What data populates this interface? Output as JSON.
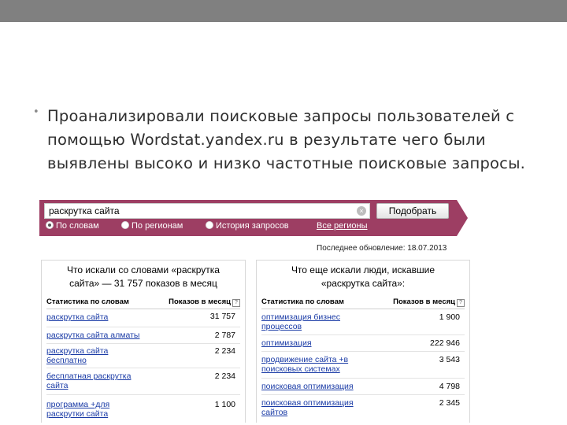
{
  "slide": {
    "bullet": "•",
    "text": "Проанализировали поисковые запросы пользователей с помощью Wordstat.yandex.ru в результате чего были выявлены высоко и низко частотные поисковые запросы."
  },
  "search": {
    "query": "раскрутка сайта",
    "button_label": "Подобрать",
    "clear_glyph": "×"
  },
  "modes": [
    {
      "label": "По словам",
      "selected": true
    },
    {
      "label": "По регионам",
      "selected": false
    },
    {
      "label": "История запросов",
      "selected": false
    }
  ],
  "all_regions": "Все регионы",
  "last_update": "Последнее обновление: 18.07.2013",
  "left_table": {
    "title": "Что искали со словами «раскрутка сайта» — 31 757 показов в месяц",
    "col_words": "Статистика по словам",
    "col_shows": "Показов в месяц",
    "help_glyph": "?",
    "rows": [
      {
        "keyword": "раскрутка сайта",
        "count": "31 757"
      },
      {
        "keyword": "раскрутка сайта алматы",
        "count": "2 787"
      },
      {
        "keyword": "раскрутка сайта бесплатно",
        "count": "2 234"
      },
      {
        "keyword": "бесплатная раскрутка сайта",
        "count": "2 234"
      },
      {
        "keyword": "программа +для раскрутки сайта",
        "count": "1 100"
      }
    ]
  },
  "right_table": {
    "title": "Что еще искали люди, искавшие «раскрутка сайта»:",
    "col_words": "Статистика по словам",
    "col_shows": "Показов в месяц",
    "help_glyph": "?",
    "rows": [
      {
        "keyword": "оптимизация бизнес процессов",
        "count": "1 900"
      },
      {
        "keyword": "оптимизация",
        "count": "222 946"
      },
      {
        "keyword": "продвижение сайта +в поисковых системах",
        "count": "3 543"
      },
      {
        "keyword": "поисковая оптимизация",
        "count": "4 798"
      },
      {
        "keyword": "поисковая оптимизация сайтов",
        "count": "2 345"
      }
    ]
  },
  "colors": {
    "wordstat_bar": "#9d3e63",
    "link": "#1a3ba6",
    "top_band": "#808080"
  }
}
